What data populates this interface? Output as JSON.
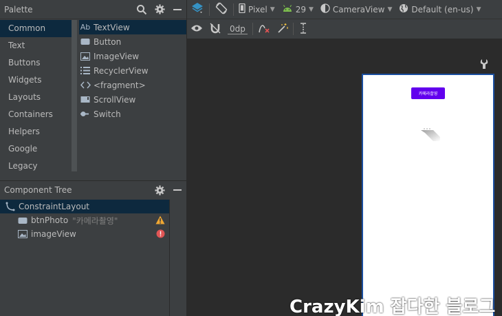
{
  "palette": {
    "title": "Palette",
    "categories": [
      "Common",
      "Text",
      "Buttons",
      "Widgets",
      "Layouts",
      "Containers",
      "Helpers",
      "Google",
      "Legacy"
    ],
    "selected_category": "Common",
    "widgets": [
      {
        "label": "TextView",
        "icon": "ab-text-icon",
        "icon_text": "Ab"
      },
      {
        "label": "Button",
        "icon": "button-icon"
      },
      {
        "label": "ImageView",
        "icon": "image-icon"
      },
      {
        "label": "RecyclerView",
        "icon": "list-icon"
      },
      {
        "label": "<fragment>",
        "icon": "code-brackets-icon"
      },
      {
        "label": "ScrollView",
        "icon": "scrollview-icon"
      },
      {
        "label": "Switch",
        "icon": "switch-icon"
      }
    ]
  },
  "component_tree": {
    "title": "Component Tree",
    "items": [
      {
        "label": "ConstraintLayout",
        "icon": "constraint-layout-icon"
      },
      {
        "label": "btnPhoto",
        "attr": "\"카메라촬영\"",
        "icon": "button-icon",
        "status": "warning-icon"
      },
      {
        "label": "imageView",
        "icon": "image-icon",
        "status": "error-icon"
      }
    ]
  },
  "toolbar": {
    "device": "Pixel",
    "api": "29",
    "theme": "CameraView",
    "locale": "Default (en-us)",
    "default_margin": "0dp"
  },
  "preview": {
    "button_text": "카메라촬영"
  },
  "watermark": "CrazyKim 잡다한 블로그",
  "colors": {
    "accent_button": "#6200ee",
    "selection": "#0d293e",
    "panel": "#3c3f41",
    "warning": "#f0a732",
    "error": "#e05555"
  }
}
